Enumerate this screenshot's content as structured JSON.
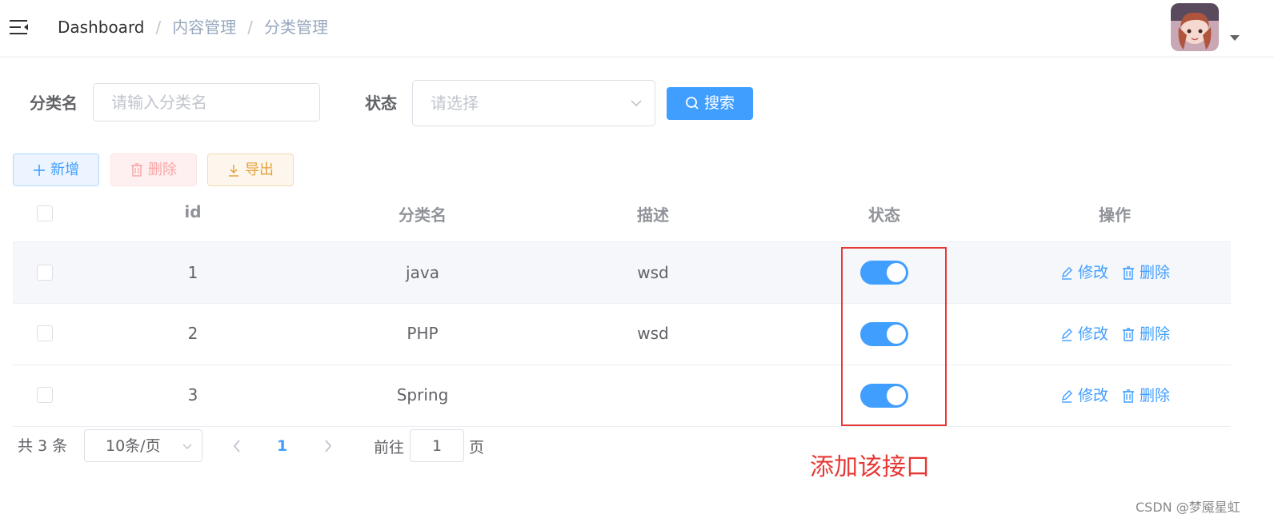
{
  "header": {
    "breadcrumb": [
      "Dashboard",
      "内容管理",
      "分类管理"
    ]
  },
  "search": {
    "name_label": "分类名",
    "name_placeholder": "请输入分类名",
    "status_label": "状态",
    "status_placeholder": "请选择",
    "search_button": "搜索"
  },
  "toolbar": {
    "add_label": "新增",
    "delete_label": "删除",
    "export_label": "导出"
  },
  "table": {
    "columns": [
      "id",
      "分类名",
      "描述",
      "状态",
      "操作"
    ],
    "rows": [
      {
        "id": "1",
        "name": "java",
        "desc": "wsd",
        "status_on": true
      },
      {
        "id": "2",
        "name": "PHP",
        "desc": "wsd",
        "status_on": true
      },
      {
        "id": "3",
        "name": "Spring",
        "desc": "",
        "status_on": true
      }
    ],
    "edit_label": "修改",
    "delete_label": "删除"
  },
  "pagination": {
    "total_text": "共 3 条",
    "page_size": "10条/页",
    "current_page": "1",
    "goto_prefix": "前往",
    "goto_value": "1",
    "goto_suffix": "页"
  },
  "annotation": {
    "text": "添加该接口",
    "color": "#e53935"
  },
  "watermark": "CSDN @梦魇星虹",
  "colors": {
    "primary": "#409eff",
    "danger_light": "#fef0f0",
    "warning": "#e6a23c"
  },
  "icons": {
    "menu": "hamburger-icon",
    "search": "search-icon",
    "add": "plus-icon",
    "delete": "trash-icon",
    "export": "download-icon",
    "edit": "edit-icon"
  }
}
